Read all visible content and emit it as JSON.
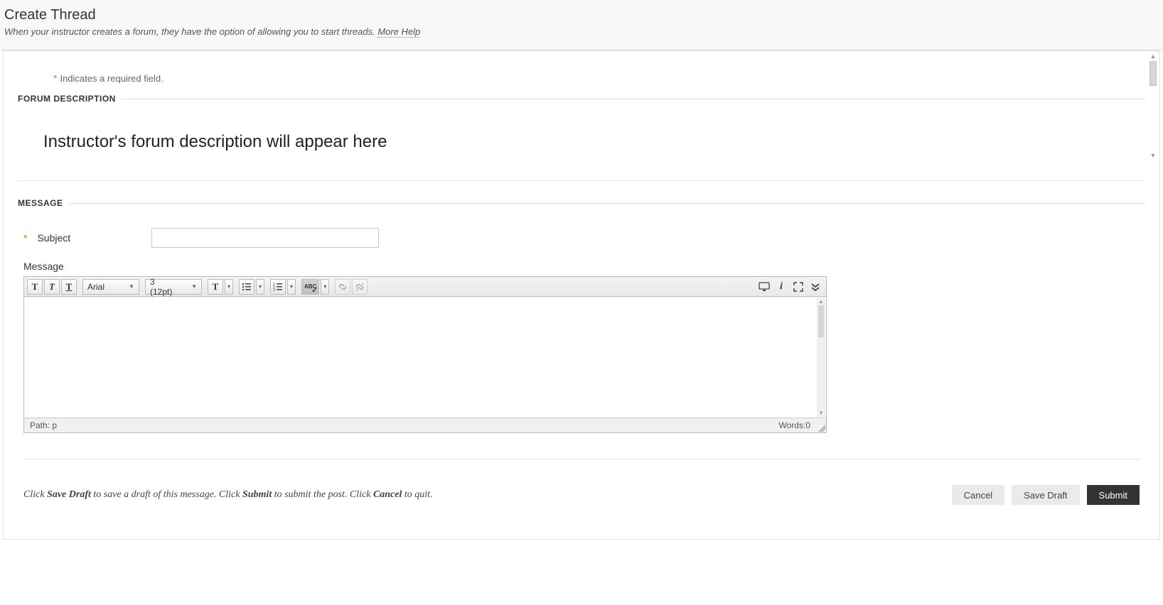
{
  "header": {
    "title": "Create Thread",
    "subtitle_prefix": "When your instructor creates a forum, they have the option of allowing you to start threads. ",
    "more_help": "More Help"
  },
  "required_note": "Indicates a required field.",
  "sections": {
    "forum_description_label": "FORUM DESCRIPTION",
    "forum_description_text": "Instructor's forum description will appear here",
    "message_label": "MESSAGE"
  },
  "fields": {
    "subject_label": "Subject",
    "subject_value": "",
    "message_label": "Message"
  },
  "editor": {
    "font_family": "Arial",
    "font_size": "3 (12pt)",
    "path_prefix": "Path: ",
    "path_value": "p",
    "words_prefix": "Words:",
    "words_value": "0",
    "toolbar": {
      "bold": "T",
      "italic": "T",
      "underline": "T",
      "spellcheck": "ABC"
    }
  },
  "footer": {
    "help_click1": "Click ",
    "help_savedraft_b": "Save Draft",
    "help_mid1": " to save a draft of this message. Click ",
    "help_submit_b": "Submit",
    "help_mid2": " to submit the post. Click ",
    "help_cancel_b": "Cancel",
    "help_end": " to quit.",
    "cancel": "Cancel",
    "save_draft": "Save Draft",
    "submit": "Submit"
  }
}
